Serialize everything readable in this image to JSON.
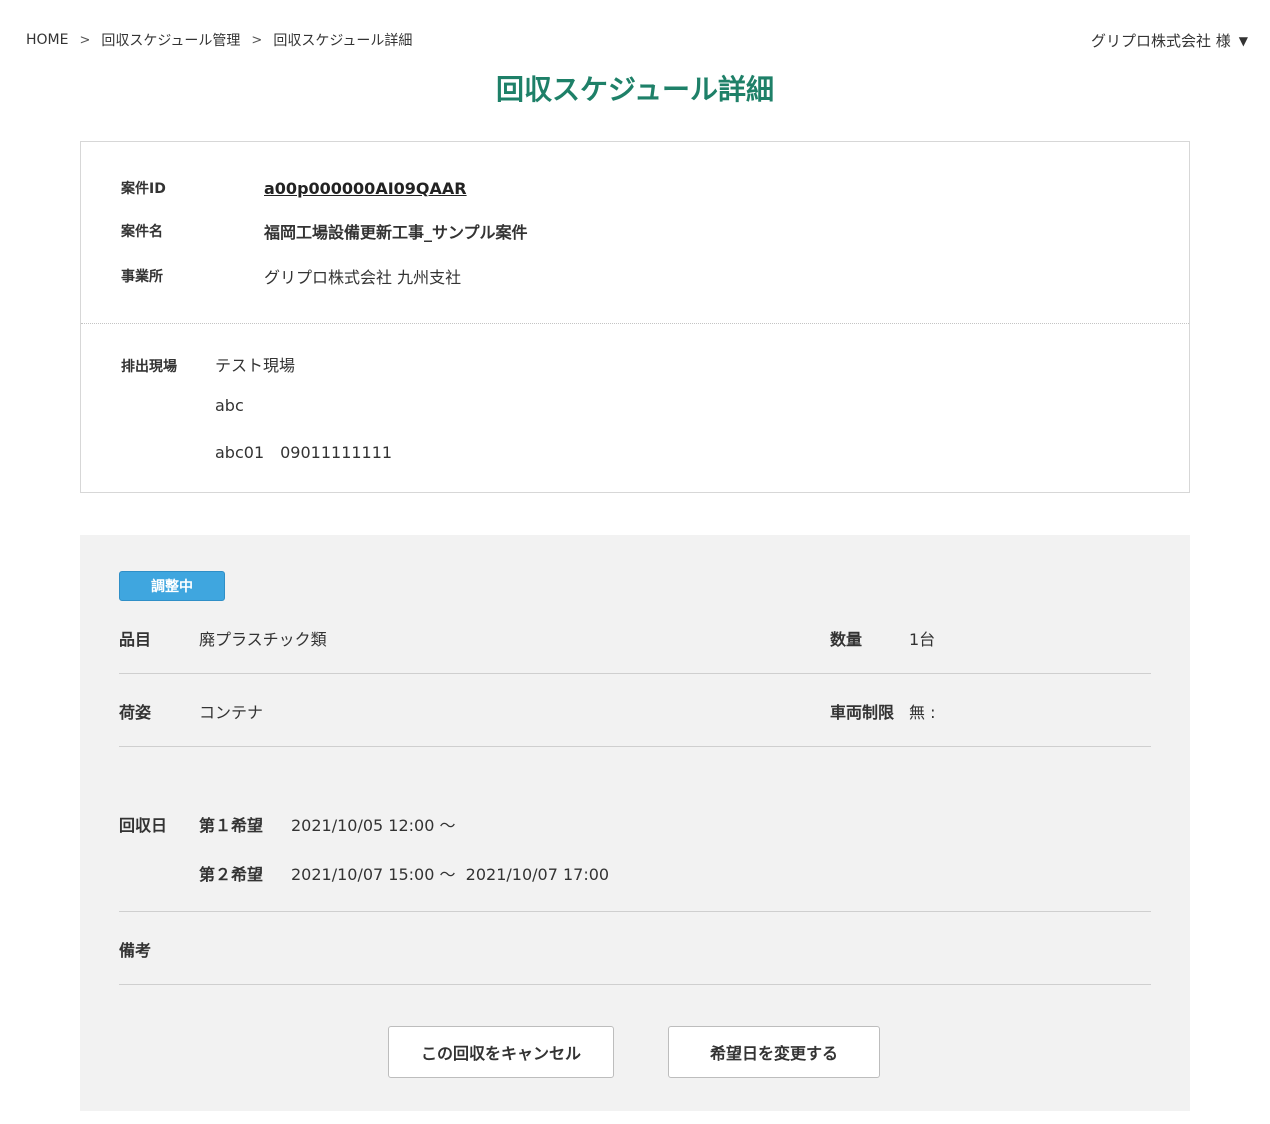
{
  "breadcrumb": {
    "home": "HOME",
    "level1": "回収スケジュール管理",
    "level2": "回収スケジュール詳細"
  },
  "user": {
    "name": "グリプロ株式会社 様",
    "caret": "▼"
  },
  "page_title": "回収スケジュール詳細",
  "project": {
    "id_label": "案件ID",
    "id_value": "a00p000000AI09QAAR",
    "name_label": "案件名",
    "name_value": "福岡工場設備更新工事_サンプル案件",
    "office_label": "事業所",
    "office_value": "グリプロ株式会社 九州支社"
  },
  "site": {
    "label": "排出現場",
    "lines": [
      "テスト現場",
      "abc",
      "abc01　09011111111"
    ]
  },
  "detail": {
    "status": "調整中",
    "status_color": "#3fa6df",
    "item_label": "品目",
    "item_value": "廃プラスチック類",
    "quantity_label": "数量",
    "quantity_value": "1台",
    "packing_label": "荷姿",
    "packing_value": "コンテナ",
    "vehicle_label": "車両制限",
    "vehicle_value": "無 :",
    "date_label": "回収日",
    "choice1_label": "第１希望",
    "choice1_value": "2021/10/05 12:00 〜",
    "choice2_label": "第２希望",
    "choice2_value": "2021/10/07 15:00 〜  2021/10/07 17:00",
    "remarks_label": "備考",
    "remarks_value": ""
  },
  "actions": {
    "cancel_label": "この回収をキャンセル",
    "change_label": "希望日を変更する"
  },
  "colors": {
    "title_green": "#1e8068",
    "badge_blue": "#3fa6df"
  }
}
